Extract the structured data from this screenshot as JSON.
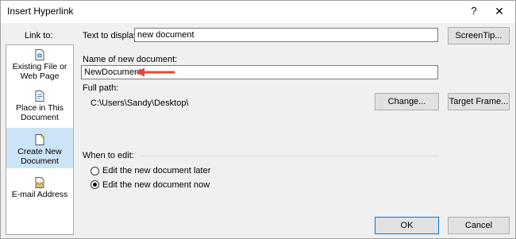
{
  "window": {
    "title": "Insert Hyperlink",
    "help_glyph": "?",
    "close_glyph": "✕"
  },
  "sidebar": {
    "label": "Link to:",
    "items": [
      {
        "line1": "Existing File or",
        "line2": "Web Page",
        "icon": "existing-file-icon",
        "selected": false
      },
      {
        "line1": "Place in This",
        "line2": "Document",
        "icon": "place-in-document-icon",
        "selected": false
      },
      {
        "line1": "Create New",
        "line2": "Document",
        "icon": "create-new-document-icon",
        "selected": true
      },
      {
        "line1": "E-mail Address",
        "line2": "",
        "icon": "email-icon",
        "selected": false
      }
    ]
  },
  "display": {
    "label": "Text to display:",
    "value": "new document",
    "screentip_button": "ScreenTip..."
  },
  "new_document": {
    "label": "Name of new document:",
    "value": "NewDocument"
  },
  "full_path": {
    "label": "Full path:",
    "value": "C:\\Users\\Sandy\\Desktop\\",
    "change_button": "Change...",
    "target_frame_button": "Target Frame..."
  },
  "when_to_edit": {
    "label": "When to edit:",
    "options": [
      {
        "label": "Edit the new document later",
        "checked": false
      },
      {
        "label": "Edit the new document now",
        "checked": true
      }
    ]
  },
  "footer": {
    "ok_button": "OK",
    "cancel_button": "Cancel"
  },
  "colors": {
    "selected_background": "#cce4f7",
    "arrow": "#e8453c",
    "default_button_border": "#0078d7"
  }
}
